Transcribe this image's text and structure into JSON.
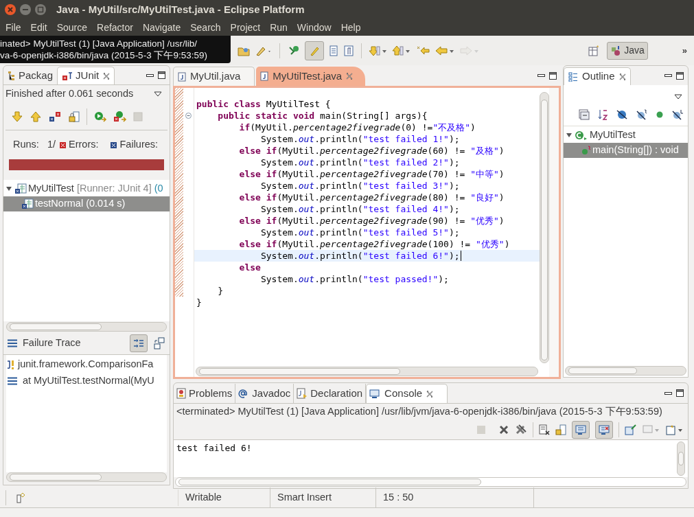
{
  "window": {
    "title": "Java - MyUtil/src/MyUtilTest.java - Eclipse Platform"
  },
  "menu": [
    "File",
    "Edit",
    "Source",
    "Refactor",
    "Navigate",
    "Search",
    "Project",
    "Run",
    "Window",
    "Help"
  ],
  "tooltip": {
    "lines": [
      "inated> MyUtilTest (1) [Java Application] /usr/lib/",
      "va-6-openjdk-i386/bin/java (2015-5-3 下午9:53:59)"
    ]
  },
  "toolbar": {
    "highlight_toggle": {
      "on": true
    },
    "forward": {
      "disabled": true
    }
  },
  "perspective": {
    "label": "Java",
    "selected": true
  },
  "more_button": "»",
  "left_panel": {
    "tabs": [
      {
        "label": "Packag",
        "selected": false
      },
      {
        "label": "JUnit",
        "selected": true
      }
    ],
    "status": "Finished after 0.061 seconds",
    "counters": [
      {
        "label": "Runs:",
        "value": "1/"
      },
      {
        "label": "Errors:",
        "kind": "error"
      },
      {
        "label": "Failures:",
        "kind": "failure"
      }
    ],
    "progress": {
      "level": 1,
      "failed": true
    },
    "tree": [
      {
        "label": "MyUtilTest",
        "detail": "[Runner: JUnit 4]",
        "extra": "(0",
        "expanded": true,
        "selected": false,
        "children": [
          {
            "label": "testNormal (0.014 s)",
            "selected": true
          }
        ]
      }
    ],
    "failure_trace": {
      "title": "Failure Trace",
      "filter_on": true,
      "lines": [
        {
          "kind": "exception",
          "text": "junit.framework.ComparisonFa"
        },
        {
          "kind": "frame",
          "text": "at MyUtilTest.testNormal(MyU"
        }
      ]
    }
  },
  "editor": {
    "tabs": [
      {
        "label": "MyUtil.java",
        "selected": false
      },
      {
        "label": "MyUtilTest.java",
        "selected": true
      }
    ],
    "lines": [
      {
        "segments": [
          {
            "kind": "keyword",
            "text": "public class"
          },
          {
            "kind": "plain",
            "text": " MyUtilTest {"
          }
        ]
      },
      {
        "fold": {
          "collapsed": false
        },
        "segments": [
          {
            "kind": "keyword",
            "text": "    public static void"
          },
          {
            "kind": "plain",
            "text": " main(String[] args){"
          }
        ]
      },
      {
        "segments": [
          {
            "kind": "keyword",
            "text": "        if"
          },
          {
            "kind": "plain",
            "text": "(MyUtil."
          },
          {
            "kind": "static_method",
            "text": "percentage2fivegrade"
          },
          {
            "kind": "plain",
            "text": "(0) !="
          },
          {
            "kind": "string",
            "text": "\"不及格\""
          },
          {
            "kind": "plain",
            "text": ")"
          }
        ]
      },
      {
        "segments": [
          {
            "kind": "plain",
            "text": "            System."
          },
          {
            "kind": "static_field",
            "text": "out"
          },
          {
            "kind": "plain",
            "text": ".println("
          },
          {
            "kind": "string",
            "text": "\"test failed 1!\""
          },
          {
            "kind": "plain",
            "text": ");"
          }
        ]
      },
      {
        "segments": [
          {
            "kind": "keyword",
            "text": "        else if"
          },
          {
            "kind": "plain",
            "text": "(MyUtil."
          },
          {
            "kind": "static_method",
            "text": "percentage2fivegrade"
          },
          {
            "kind": "plain",
            "text": "(60) != "
          },
          {
            "kind": "string",
            "text": "\"及格\""
          },
          {
            "kind": "plain",
            "text": ")"
          }
        ]
      },
      {
        "segments": [
          {
            "kind": "plain",
            "text": "            System."
          },
          {
            "kind": "static_field",
            "text": "out"
          },
          {
            "kind": "plain",
            "text": ".println("
          },
          {
            "kind": "string",
            "text": "\"test failed 2!\""
          },
          {
            "kind": "plain",
            "text": ");"
          }
        ]
      },
      {
        "segments": [
          {
            "kind": "keyword",
            "text": "        else if"
          },
          {
            "kind": "plain",
            "text": "(MyUtil."
          },
          {
            "kind": "static_method",
            "text": "percentage2fivegrade"
          },
          {
            "kind": "plain",
            "text": "(70) != "
          },
          {
            "kind": "string",
            "text": "\"中等\""
          },
          {
            "kind": "plain",
            "text": ")"
          }
        ]
      },
      {
        "segments": [
          {
            "kind": "plain",
            "text": "            System."
          },
          {
            "kind": "static_field",
            "text": "out"
          },
          {
            "kind": "plain",
            "text": ".println("
          },
          {
            "kind": "string",
            "text": "\"test failed 3!\""
          },
          {
            "kind": "plain",
            "text": ");"
          }
        ]
      },
      {
        "segments": [
          {
            "kind": "keyword",
            "text": "        else if"
          },
          {
            "kind": "plain",
            "text": "(MyUtil."
          },
          {
            "kind": "static_method",
            "text": "percentage2fivegrade"
          },
          {
            "kind": "plain",
            "text": "(80) != "
          },
          {
            "kind": "string",
            "text": "\"良好\""
          },
          {
            "kind": "plain",
            "text": ")"
          }
        ]
      },
      {
        "segments": [
          {
            "kind": "plain",
            "text": "            System."
          },
          {
            "kind": "static_field",
            "text": "out"
          },
          {
            "kind": "plain",
            "text": ".println("
          },
          {
            "kind": "string",
            "text": "\"test failed 4!\""
          },
          {
            "kind": "plain",
            "text": ");"
          }
        ]
      },
      {
        "segments": [
          {
            "kind": "keyword",
            "text": "        else if"
          },
          {
            "kind": "plain",
            "text": "(MyUtil."
          },
          {
            "kind": "static_method",
            "text": "percentage2fivegrade"
          },
          {
            "kind": "plain",
            "text": "(90) != "
          },
          {
            "kind": "string",
            "text": "\"优秀\""
          },
          {
            "kind": "plain",
            "text": ")"
          }
        ]
      },
      {
        "segments": [
          {
            "kind": "plain",
            "text": "            System."
          },
          {
            "kind": "static_field",
            "text": "out"
          },
          {
            "kind": "plain",
            "text": ".println("
          },
          {
            "kind": "string",
            "text": "\"test failed 5!\""
          },
          {
            "kind": "plain",
            "text": ");"
          }
        ]
      },
      {
        "segments": [
          {
            "kind": "keyword",
            "text": "        else if"
          },
          {
            "kind": "plain",
            "text": "(MyUtil."
          },
          {
            "kind": "static_method",
            "text": "percentage2fivegrade"
          },
          {
            "kind": "plain",
            "text": "(100) != "
          },
          {
            "kind": "string",
            "text": "\"优秀\""
          },
          {
            "kind": "plain",
            "text": ")"
          }
        ]
      },
      {
        "current": true,
        "segments": [
          {
            "kind": "plain",
            "text": "            System."
          },
          {
            "kind": "static_field",
            "text": "out"
          },
          {
            "kind": "plain",
            "text": ".println("
          },
          {
            "kind": "string",
            "text": "\"test failed 6!\""
          },
          {
            "kind": "plain",
            "text": ");"
          }
        ]
      },
      {
        "segments": [
          {
            "kind": "keyword",
            "text": "        else"
          }
        ]
      },
      {
        "segments": [
          {
            "kind": "plain",
            "text": "            System."
          },
          {
            "kind": "static_field",
            "text": "out"
          },
          {
            "kind": "plain",
            "text": ".println("
          },
          {
            "kind": "string",
            "text": "\"test passed!\""
          },
          {
            "kind": "plain",
            "text": ");"
          }
        ]
      },
      {
        "segments": [
          {
            "kind": "plain",
            "text": "    }"
          }
        ]
      },
      {
        "segments": [
          {
            "kind": "plain",
            "text": "}"
          }
        ]
      }
    ]
  },
  "outline": {
    "tab": {
      "label": "Outline",
      "selected": true
    },
    "tree": [
      {
        "label": "MyUtilTest",
        "expanded": true,
        "selected": false,
        "children": [
          {
            "label": "main(String[]) : void",
            "selected": true
          }
        ]
      }
    ]
  },
  "console": {
    "tabs": [
      {
        "label": "Problems",
        "selected": false
      },
      {
        "label": "Javadoc",
        "selected": false
      },
      {
        "label": "Declaration",
        "selected": false
      },
      {
        "label": "Console",
        "selected": true
      }
    ],
    "header": "<terminated> MyUtilTest (1) [Java Application] /usr/lib/jvm/java-6-openjdk-i386/bin/java (2015-5-3 下午9:53:59)",
    "toggles": [
      {
        "on": true
      },
      {
        "on": true
      }
    ],
    "output": "test failed 6!"
  },
  "status_bar": [
    "Writable",
    "Smart Insert",
    "15 : 50"
  ]
}
